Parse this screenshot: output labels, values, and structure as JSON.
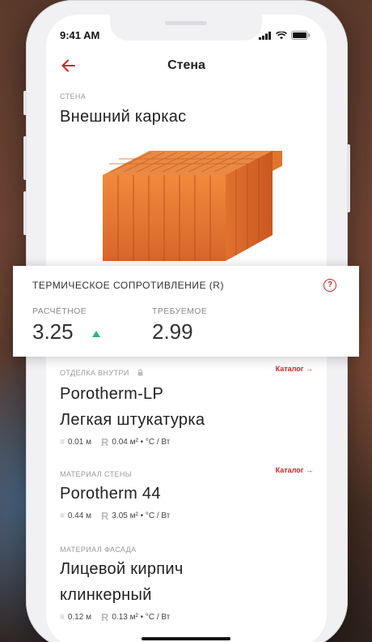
{
  "status": {
    "time": "9:41 AM"
  },
  "header": {
    "title": "Стена"
  },
  "wall": {
    "eyebrow": "СТЕНА",
    "name": "Внешний каркас"
  },
  "thermal": {
    "title": "ТЕРМИЧЕСКОЕ СОПРОТИВЛЕНИЕ (R)",
    "help": "?",
    "calculated_label": "РАСЧЁТНОЕ",
    "calculated_value": "3.25",
    "required_label": "ТРЕБУЕМОЕ",
    "required_value": "2.99"
  },
  "layers": [
    {
      "eyebrow": "ОТДЕЛКА ВНУТРИ",
      "catalog": "Каталог",
      "name_line1": "Porotherm-LP",
      "name_line2": "Легкая штукатурка",
      "thickness": "0.01 м",
      "r_value": "0.04 м² • °C / Вт"
    },
    {
      "eyebrow": "МАТЕРИАЛ СТЕНЫ",
      "catalog": "Каталог",
      "name_line1": "Porotherm 44",
      "thickness": "0.44 м",
      "r_value": "3.05 м² • °C / Вт"
    },
    {
      "eyebrow": "МАТЕРИАЛ ФАСАДА",
      "name_line1": "Лицевой кирпич",
      "name_line2": "клинкерный",
      "thickness": "0.12 м",
      "r_value": "0.13 м² • °C / Вт"
    }
  ],
  "r_symbol": "R",
  "colors": {
    "accent": "#c62828",
    "up": "#2eb872",
    "brick": "#e8792e"
  }
}
